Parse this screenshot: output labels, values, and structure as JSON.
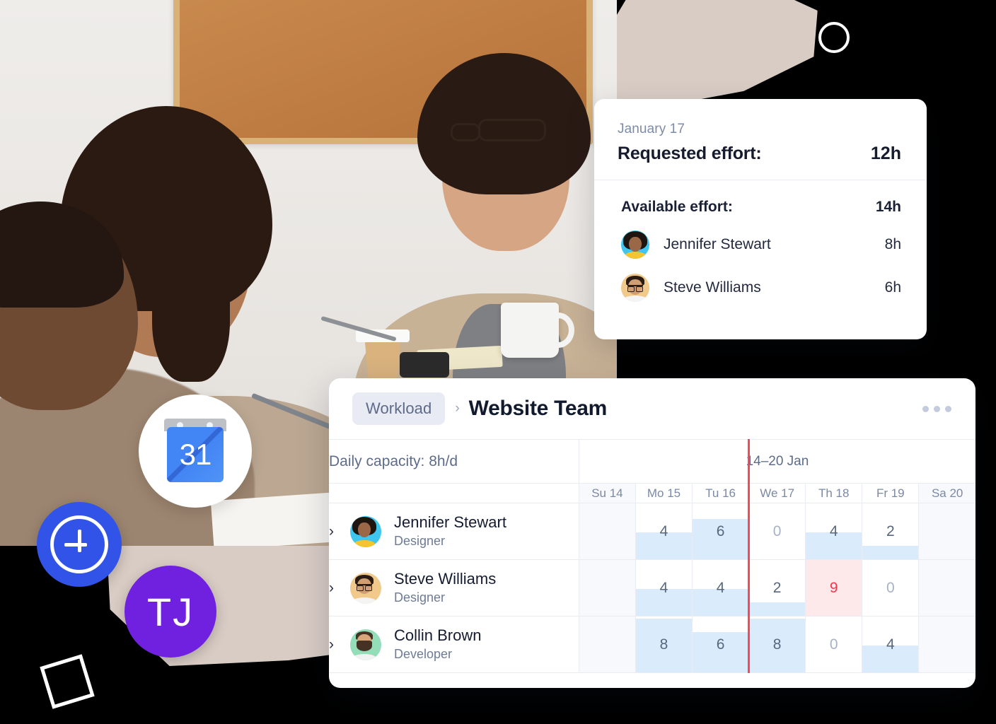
{
  "effort_card": {
    "date": "January 17",
    "requested_label": "Requested effort:",
    "requested_value": "12h",
    "available_label": "Available effort:",
    "available_value": "14h",
    "people": [
      {
        "avatar": "avatar-jennifer",
        "name": "Jennifer Stewart",
        "hours": "8h"
      },
      {
        "avatar": "avatar-steve",
        "name": "Steve Williams",
        "hours": "6h"
      }
    ]
  },
  "workload_card": {
    "breadcrumb_chip": "Workload",
    "breadcrumb_separator": "›",
    "title": "Website Team",
    "more_icon": "ellipsis-icon",
    "capacity_label": "Daily capacity: 8h/d",
    "week_label": "14–20 Jan",
    "day_columns": [
      {
        "label": "Su 14",
        "weekend": true
      },
      {
        "label": "Mo 15",
        "weekend": false
      },
      {
        "label": "Tu 16",
        "weekend": false
      },
      {
        "label": "We 17",
        "weekend": false
      },
      {
        "label": "Th 18",
        "weekend": false
      },
      {
        "label": "Fr 19",
        "weekend": false
      },
      {
        "label": "Sa 20",
        "weekend": true
      }
    ],
    "today_marker_after_column": 2,
    "capacity_hours": 8,
    "rows": [
      {
        "avatar": "avatar-jennifer",
        "name": "Jennifer Stewart",
        "role": "Designer",
        "expand_icon": "chevron-right-icon",
        "cells": [
          {
            "value": "",
            "hours": null,
            "weekend": true,
            "over": false
          },
          {
            "value": "4",
            "hours": 4,
            "weekend": false,
            "over": false
          },
          {
            "value": "6",
            "hours": 6,
            "weekend": false,
            "over": false
          },
          {
            "value": "0",
            "hours": 0,
            "weekend": false,
            "over": false
          },
          {
            "value": "4",
            "hours": 4,
            "weekend": false,
            "over": false
          },
          {
            "value": "2",
            "hours": 2,
            "weekend": false,
            "over": false
          },
          {
            "value": "",
            "hours": null,
            "weekend": true,
            "over": false
          }
        ]
      },
      {
        "avatar": "avatar-steve",
        "name": "Steve Williams",
        "role": "Designer",
        "expand_icon": "chevron-right-icon",
        "cells": [
          {
            "value": "",
            "hours": null,
            "weekend": true,
            "over": false
          },
          {
            "value": "4",
            "hours": 4,
            "weekend": false,
            "over": false
          },
          {
            "value": "4",
            "hours": 4,
            "weekend": false,
            "over": false
          },
          {
            "value": "2",
            "hours": 2,
            "weekend": false,
            "over": false
          },
          {
            "value": "9",
            "hours": 9,
            "weekend": false,
            "over": true
          },
          {
            "value": "0",
            "hours": 0,
            "weekend": false,
            "over": false
          },
          {
            "value": "",
            "hours": null,
            "weekend": true,
            "over": false
          }
        ]
      },
      {
        "avatar": "avatar-collin",
        "name": "Collin Brown",
        "role": "Developer",
        "expand_icon": "chevron-right-icon",
        "cells": [
          {
            "value": "",
            "hours": null,
            "weekend": true,
            "over": false
          },
          {
            "value": "8",
            "hours": 8,
            "weekend": false,
            "over": false
          },
          {
            "value": "6",
            "hours": 6,
            "weekend": false,
            "over": false
          },
          {
            "value": "8",
            "hours": 8,
            "weekend": false,
            "over": false
          },
          {
            "value": "0",
            "hours": 0,
            "weekend": false,
            "over": false
          },
          {
            "value": "4",
            "hours": 4,
            "weekend": false,
            "over": false
          },
          {
            "value": "",
            "hours": null,
            "weekend": true,
            "over": false
          }
        ]
      }
    ]
  },
  "floating": {
    "calendar_icon": "google-calendar-icon",
    "calendar_day": "31",
    "add_icon": "plus-circle-icon",
    "avatar_initials": "TJ"
  },
  "decorations": {
    "ring": "circle-outline-shape",
    "square": "square-outline-shape",
    "brush_top": "brush-stroke-shape",
    "brush_bottom": "brush-stroke-shape"
  },
  "colors": {
    "accent_blue": "#3253E8",
    "bar_blue": "#DAEBFB",
    "over_red": "#F1364B",
    "over_bg": "#FDE8EA",
    "today_line": "#FA4659",
    "purple": "#7021E0",
    "brush_beige": "#D9CCC5",
    "chip_bg": "#E8EBF4"
  }
}
